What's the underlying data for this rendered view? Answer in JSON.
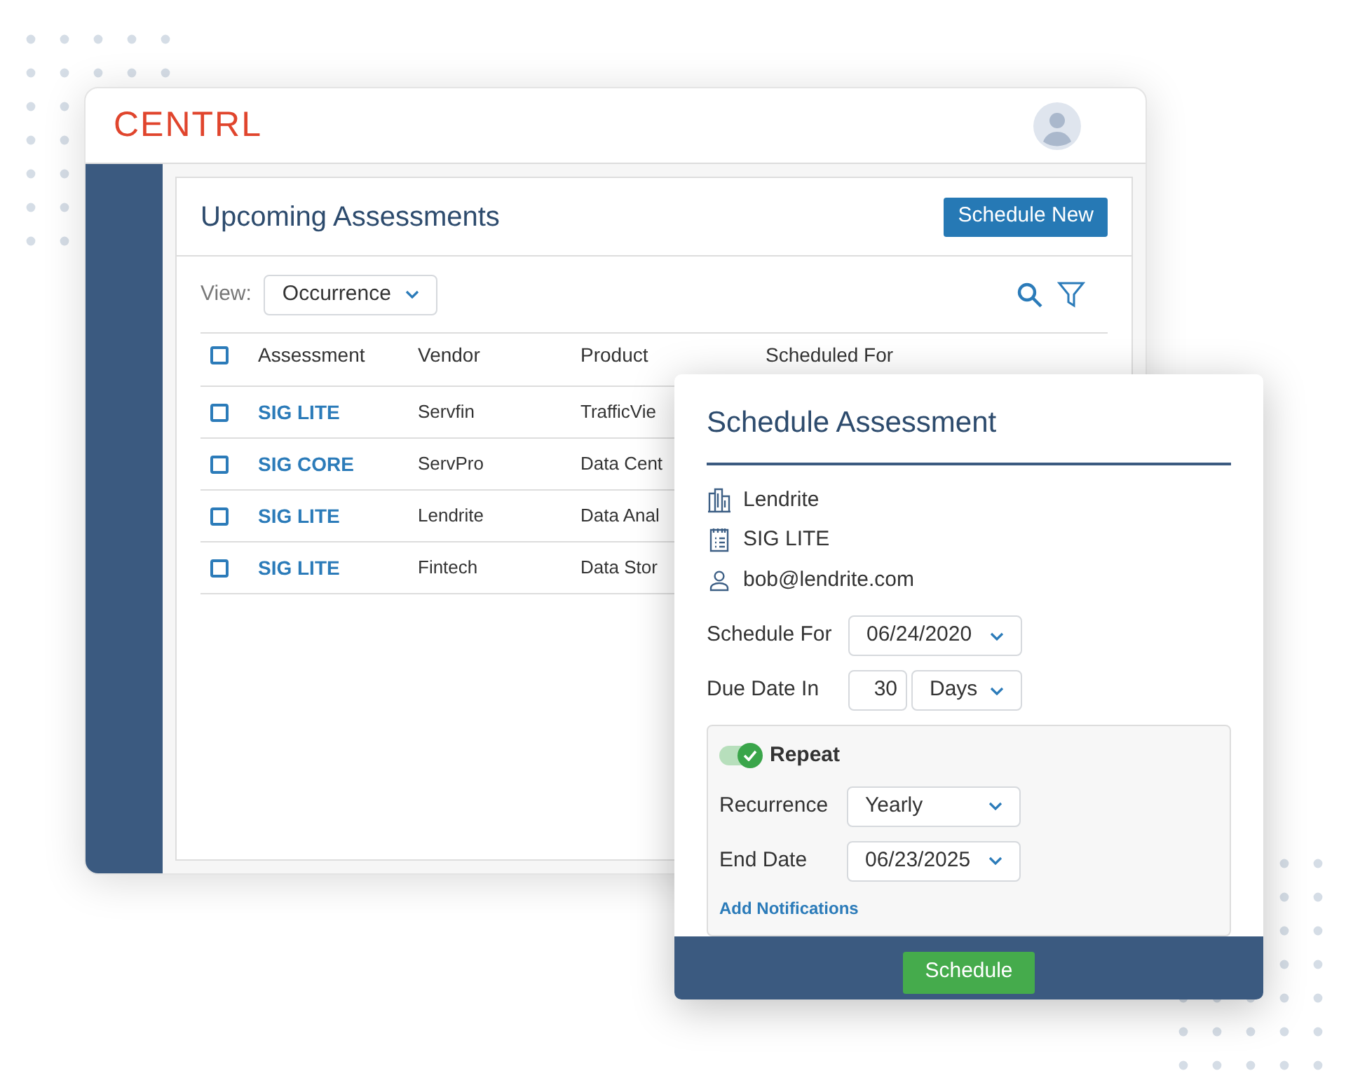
{
  "app": {
    "logo": "CENTRL"
  },
  "panel": {
    "title": "Upcoming Assessments",
    "action": "Schedule New",
    "view_label": "View:",
    "view_value": "Occurrence"
  },
  "table": {
    "columns": [
      {
        "label": "Assessment",
        "checked": false
      },
      {
        "label": "Vendor"
      },
      {
        "label": "Product"
      },
      {
        "label": "Scheduled For"
      }
    ],
    "rows": [
      {
        "assessment": "SIG LITE",
        "vendor": "Servfin",
        "product": "TrafficVie",
        "checked": false
      },
      {
        "assessment": "SIG CORE",
        "vendor": "ServPro",
        "product": "Data Cent",
        "checked": false
      },
      {
        "assessment": "SIG LITE",
        "vendor": "Lendrite",
        "product": "Data Anal",
        "checked": false
      },
      {
        "assessment": "SIG LITE",
        "vendor": "Fintech",
        "product": "Data Stor",
        "checked": false
      }
    ]
  },
  "dialog": {
    "title": "Schedule Assessment",
    "details": [
      {
        "kind": "building",
        "text": "Lendrite"
      },
      {
        "kind": "form",
        "text": "SIG LITE"
      },
      {
        "kind": "person",
        "text": "bob@lendrite.com"
      }
    ],
    "schedule_for": {
      "label": "Schedule For",
      "value": "06/24/2020"
    },
    "due_date": {
      "label": "Due Date In",
      "number": "30",
      "unit": "Days"
    },
    "repeat": {
      "label": "Repeat",
      "on": true,
      "recurrence": {
        "label": "Recurrence",
        "value": "Yearly"
      },
      "end_date": {
        "label": "End Date",
        "value": "06/23/2025"
      },
      "link": "Add Notifications"
    },
    "submit": "Schedule"
  }
}
